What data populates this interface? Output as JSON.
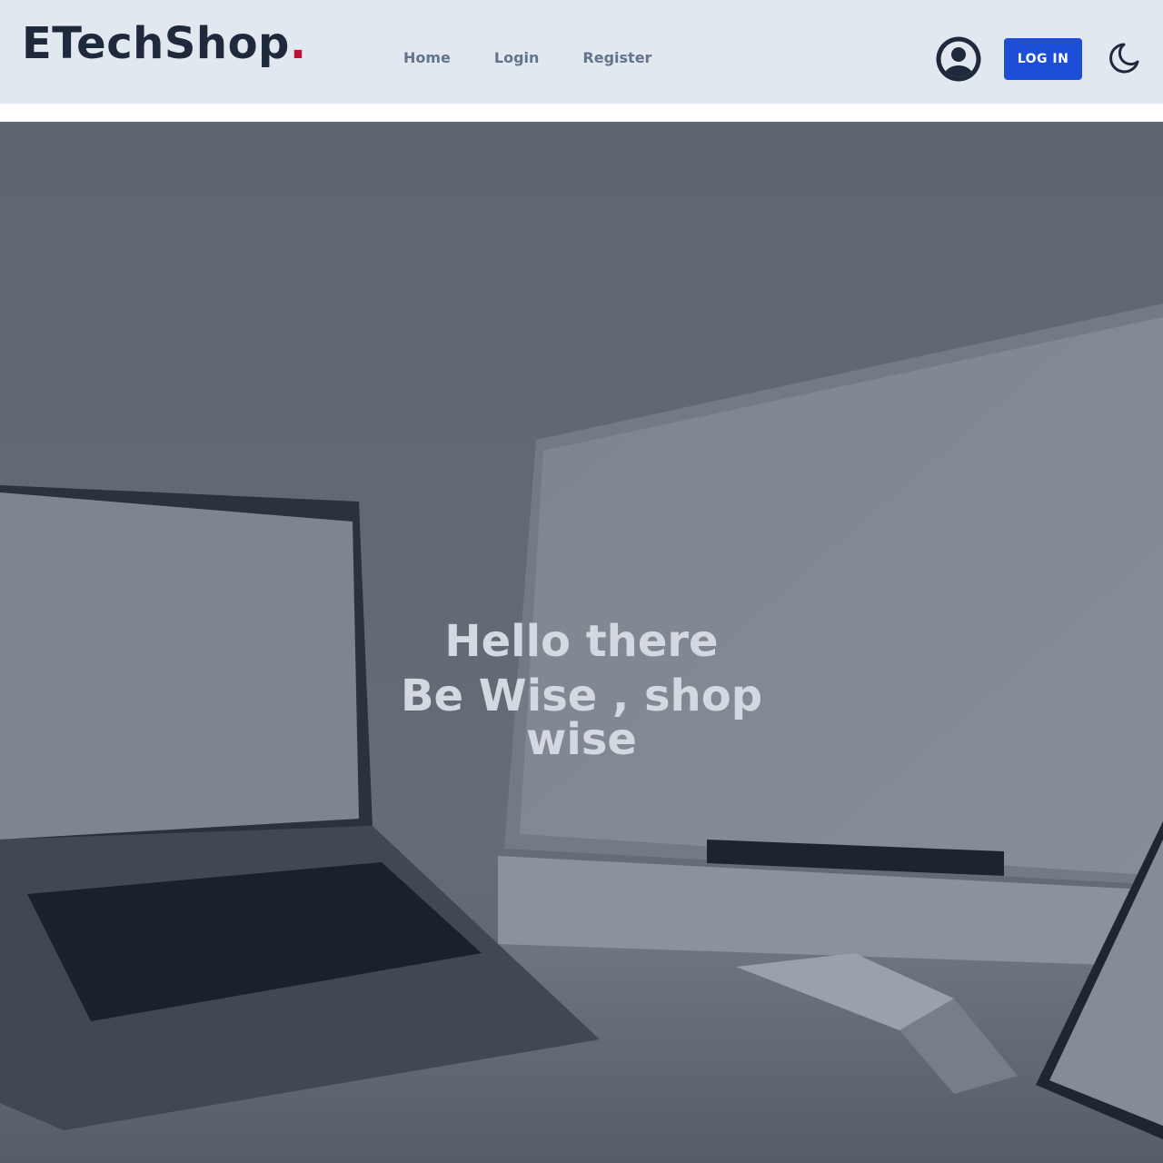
{
  "brand": {
    "name": "ETechShop",
    "dot": ".",
    "dot_color": "#be123c"
  },
  "nav": {
    "links": [
      {
        "label": "Home"
      },
      {
        "label": "Login"
      },
      {
        "label": "Register"
      }
    ]
  },
  "header": {
    "avatar_icon": "user-circle-icon",
    "login_button_label": "LOG IN",
    "theme_toggle_icon": "moon-icon",
    "accent_color": "#1d4ed8"
  },
  "hero": {
    "title": "Hello there",
    "subtitle": "Be Wise , shop wise",
    "background_image": "desk-with-laptop-and-monitor"
  }
}
